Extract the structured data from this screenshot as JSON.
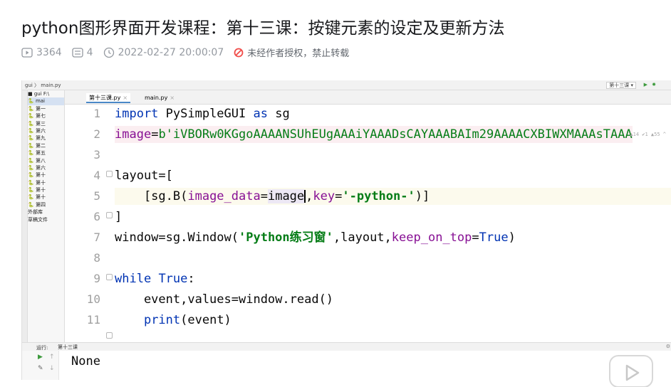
{
  "article": {
    "title": "python图形界面开发课程：第十三课：按键元素的设定及更新方法",
    "views": "3364",
    "comments": "4",
    "datetime": "2022-02-27 20:00:07",
    "copyright": "未经作者授权，禁止转载"
  },
  "ide": {
    "top_path": "gui 〉 main.py",
    "run_config": "第十三课 ▾",
    "run_icon": "▶",
    "debug_icon": "✹",
    "project_rows": [
      "■ gui  F:\\",
      "  🐍 mai",
      "  🐍 第一",
      "  🐍 第七",
      "  🐍 第三",
      "  🐍 第六",
      "  🐍 第九",
      "  🐍 第二",
      "  🐍 第五",
      "  🐍 第八",
      "  🐍 第六",
      "  🐍 第十",
      "  🐍 第十",
      "  🐍 第十",
      "  🐍 第十",
      "  🐍 第四",
      "外部库",
      "草稿文件"
    ],
    "tabs": [
      {
        "label": "第十三课.py",
        "close": "×"
      },
      {
        "label": "main.py",
        "close": "×"
      }
    ],
    "inlay": "▲14 ✔1 ▲55 ^",
    "line_numbers": [
      "1",
      "2",
      "3",
      "4",
      "5",
      "6",
      "7",
      "8",
      "9",
      "10",
      "11"
    ],
    "code": {
      "l1_kw": "import",
      "l1_mod": " PySimpleGUI ",
      "l1_as": "as",
      "l1_alias": " sg",
      "l2_var": "image",
      "l2_eq": "=",
      "l2_str": "b'iVBORw0KGgoAAAANSUhEUgAAAiYAAADsCAYAAABAIm29AAAACXBIWXMAAAsTAAA",
      "l4": "layout=[",
      "l5_pre": "    [sg.B(",
      "l5_param1": "image_data",
      "l5_eq1": "=",
      "l5_val1": "image",
      "l5_comma": ",",
      "l5_param2": "key",
      "l5_eq2": "=",
      "l5_str": "'-python-'",
      "l5_post": ")]",
      "l6": "]",
      "l7_pre": "window=sg.Window(",
      "l7_str": "'Python练习窗'",
      "l7_mid": ",layout,",
      "l7_param": "keep_on_top",
      "l7_eq": "=",
      "l7_val": "True",
      "l7_post": ")",
      "l9_kw": "while",
      "l9_sp": " ",
      "l9_val": "True",
      "l9_colon": ":",
      "l10": "    event,values=window.read()",
      "l11_indent": "    ",
      "l11_fn": "print",
      "l11_post": "(event)"
    },
    "run_label": "运行:",
    "run_tab": "第十三课",
    "console_output": "None"
  }
}
